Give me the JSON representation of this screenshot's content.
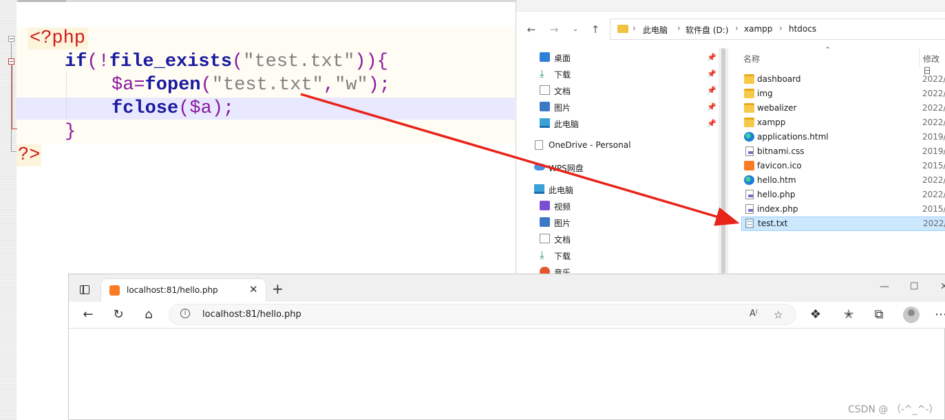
{
  "editor": {
    "code_lines": [
      {
        "parts": [
          {
            "t": "<?php",
            "c": "tag"
          }
        ]
      },
      {
        "parts": [
          {
            "t": "if",
            "c": "kw"
          },
          {
            "t": "(!",
            "c": "op"
          },
          {
            "t": "file_exists",
            "c": "fn"
          },
          {
            "t": "(",
            "c": "op"
          },
          {
            "t": "\"test.txt\"",
            "c": "str"
          },
          {
            "t": ")){",
            "c": "op"
          }
        ]
      },
      {
        "parts": [
          {
            "t": "$a",
            "c": "var"
          },
          {
            "t": "=",
            "c": "op"
          },
          {
            "t": "fopen",
            "c": "fn"
          },
          {
            "t": "(",
            "c": "op"
          },
          {
            "t": "\"test.txt\"",
            "c": "str"
          },
          {
            "t": ",",
            "c": "op"
          },
          {
            "t": "\"w\"",
            "c": "str"
          },
          {
            "t": ");",
            "c": "op"
          }
        ]
      },
      {
        "parts": [
          {
            "t": "fclose",
            "c": "fn"
          },
          {
            "t": "(",
            "c": "op"
          },
          {
            "t": "$a",
            "c": "var"
          },
          {
            "t": ");",
            "c": "op"
          }
        ]
      },
      {
        "parts": [
          {
            "t": "}",
            "c": "op"
          }
        ]
      },
      {
        "parts": [
          {
            "t": "?>",
            "c": "tag"
          }
        ]
      }
    ]
  },
  "explorer": {
    "breadcrumb": [
      "此电脑",
      "软件盘 (D:)",
      "xampp",
      "htdocs"
    ],
    "nav_items": [
      {
        "label": "桌面",
        "icon": "desktop-icon",
        "pinned": true
      },
      {
        "label": "下载",
        "icon": "download-icon",
        "pinned": true
      },
      {
        "label": "文档",
        "icon": "documents-icon",
        "pinned": true
      },
      {
        "label": "图片",
        "icon": "pictures-icon",
        "pinned": true
      },
      {
        "label": "此电脑",
        "icon": "this-pc-icon",
        "pinned": true
      },
      {
        "label": "OneDrive - Personal",
        "icon": "onedrive-icon",
        "pinned": false
      },
      {
        "label": "WPS网盘",
        "icon": "wps-cloud-icon",
        "pinned": false
      },
      {
        "label": "此电脑",
        "icon": "this-pc-icon",
        "pinned": false
      },
      {
        "label": "视频",
        "icon": "videos-icon",
        "pinned": false
      },
      {
        "label": "图片",
        "icon": "pictures-icon",
        "pinned": false
      },
      {
        "label": "文档",
        "icon": "documents-icon",
        "pinned": false
      },
      {
        "label": "下载",
        "icon": "download-icon",
        "pinned": false
      },
      {
        "label": "音乐",
        "icon": "music-icon",
        "pinned": false
      }
    ],
    "columns": {
      "name": "名称",
      "modified": "修改日"
    },
    "files": [
      {
        "name": "dashboard",
        "date": "2022/",
        "icon": "folder-icon"
      },
      {
        "name": "img",
        "date": "2022/",
        "icon": "folder-icon"
      },
      {
        "name": "webalizer",
        "date": "2022/",
        "icon": "folder-icon"
      },
      {
        "name": "xampp",
        "date": "2022/",
        "icon": "folder-icon"
      },
      {
        "name": "applications.html",
        "date": "2019/",
        "icon": "edge-html-icon"
      },
      {
        "name": "bitnami.css",
        "date": "2019/",
        "icon": "css-file-icon"
      },
      {
        "name": "favicon.ico",
        "date": "2015/",
        "icon": "xampp-ico-icon"
      },
      {
        "name": "hello.htm",
        "date": "2022/",
        "icon": "edge-html-icon"
      },
      {
        "name": "hello.php",
        "date": "2022/",
        "icon": "php-file-icon"
      },
      {
        "name": "index.php",
        "date": "2015/",
        "icon": "php-file-icon"
      },
      {
        "name": "test.txt",
        "date": "2022/",
        "icon": "text-file-icon",
        "selected": true
      }
    ]
  },
  "browser": {
    "tab_title": "localhost:81/hello.php",
    "url": "localhost:81/hello.php"
  },
  "watermark": "CSDN @ （-^_^-）",
  "colors": {
    "arrow": "#e8231a",
    "selection": "#cce8ff",
    "php_tag": "#d01c1c",
    "keyword": "#1a1a9e"
  }
}
